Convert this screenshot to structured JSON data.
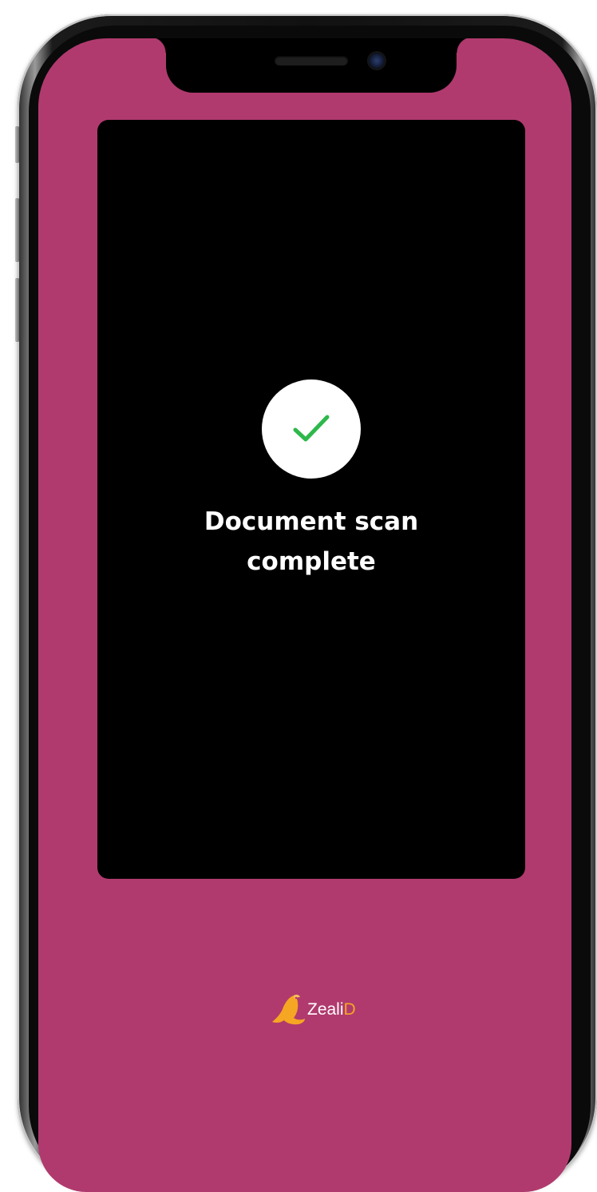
{
  "scan": {
    "line1": "Document scan",
    "line2": "complete",
    "icon": "checkmark-icon"
  },
  "brand": {
    "part1": "Zeali",
    "part2": "D",
    "logo_icon": "seal-logo-icon"
  },
  "colors": {
    "screen_background": "#b03a6e",
    "panel_background": "#000000",
    "check_green": "#2db84b",
    "brand_white": "#ffffff",
    "brand_orange": "#f5a623"
  }
}
